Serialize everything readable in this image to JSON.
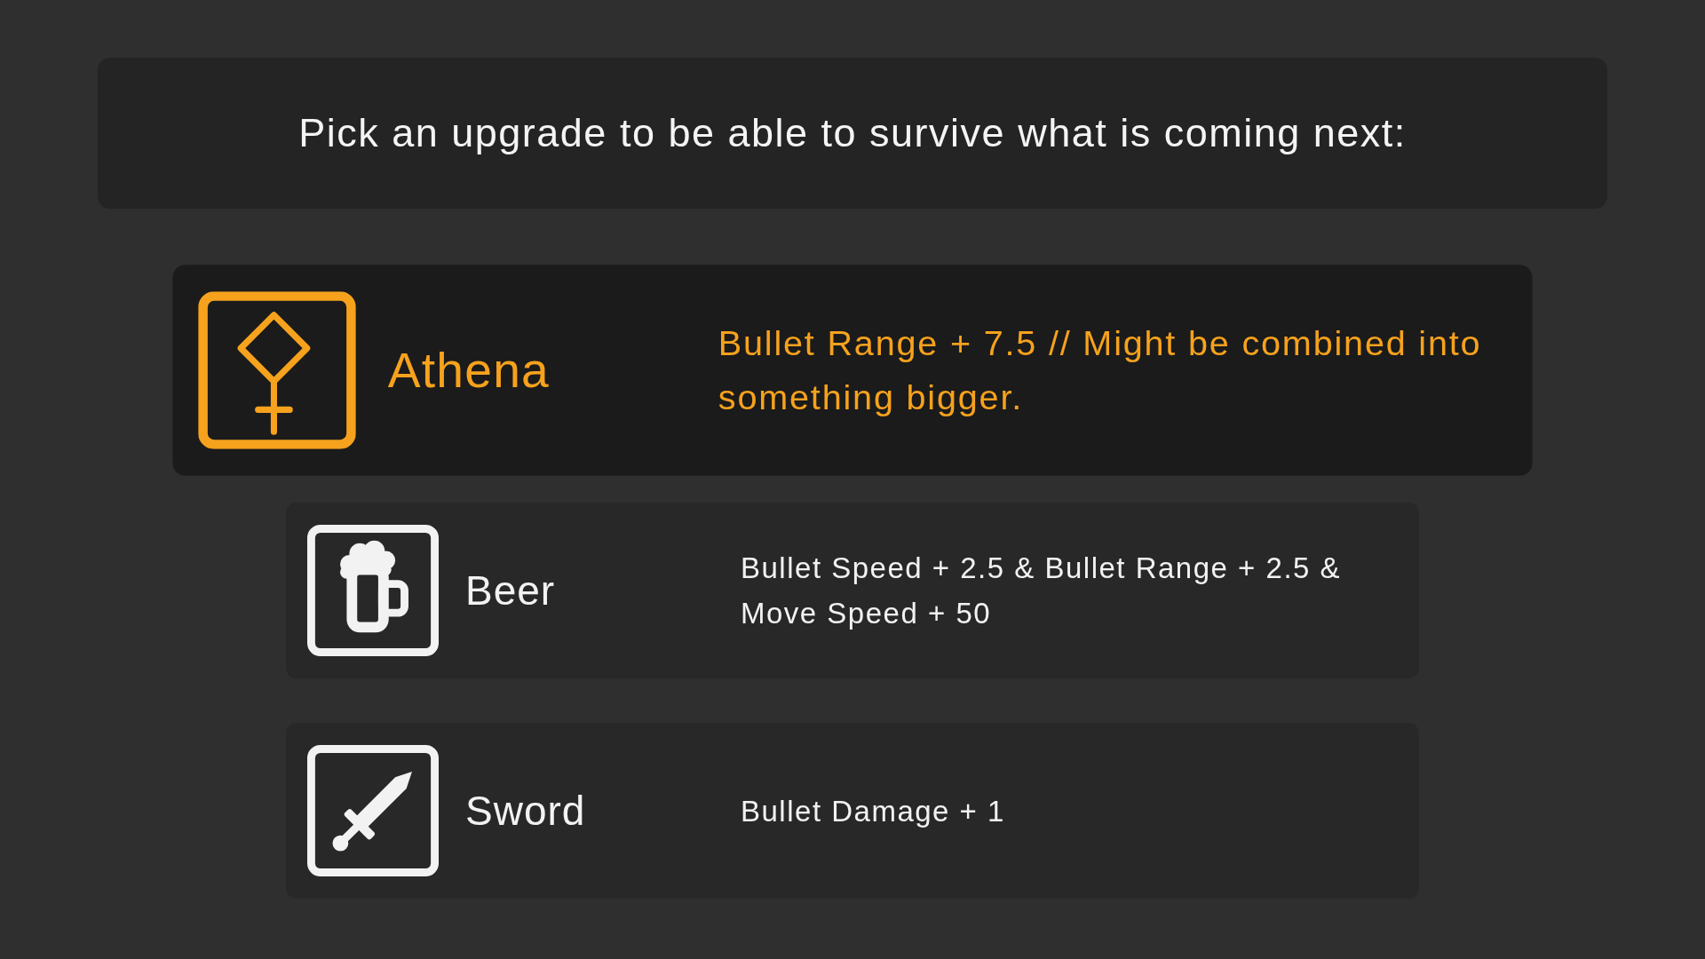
{
  "prompt": "Pick an upgrade to be able to survive what is coming next:",
  "upgrades": [
    {
      "kind": "diamond",
      "name": "Athena",
      "description": "Bullet Range + 7.5 // Might be combined into something bigger.",
      "selected": true
    },
    {
      "kind": "mug",
      "name": "Beer",
      "description": "Bullet Speed + 2.5 & Bullet Range + 2.5 & Move Speed + 50",
      "selected": false
    },
    {
      "kind": "sword",
      "name": "Sword",
      "description": "Bullet Damage + 1",
      "selected": false
    }
  ]
}
